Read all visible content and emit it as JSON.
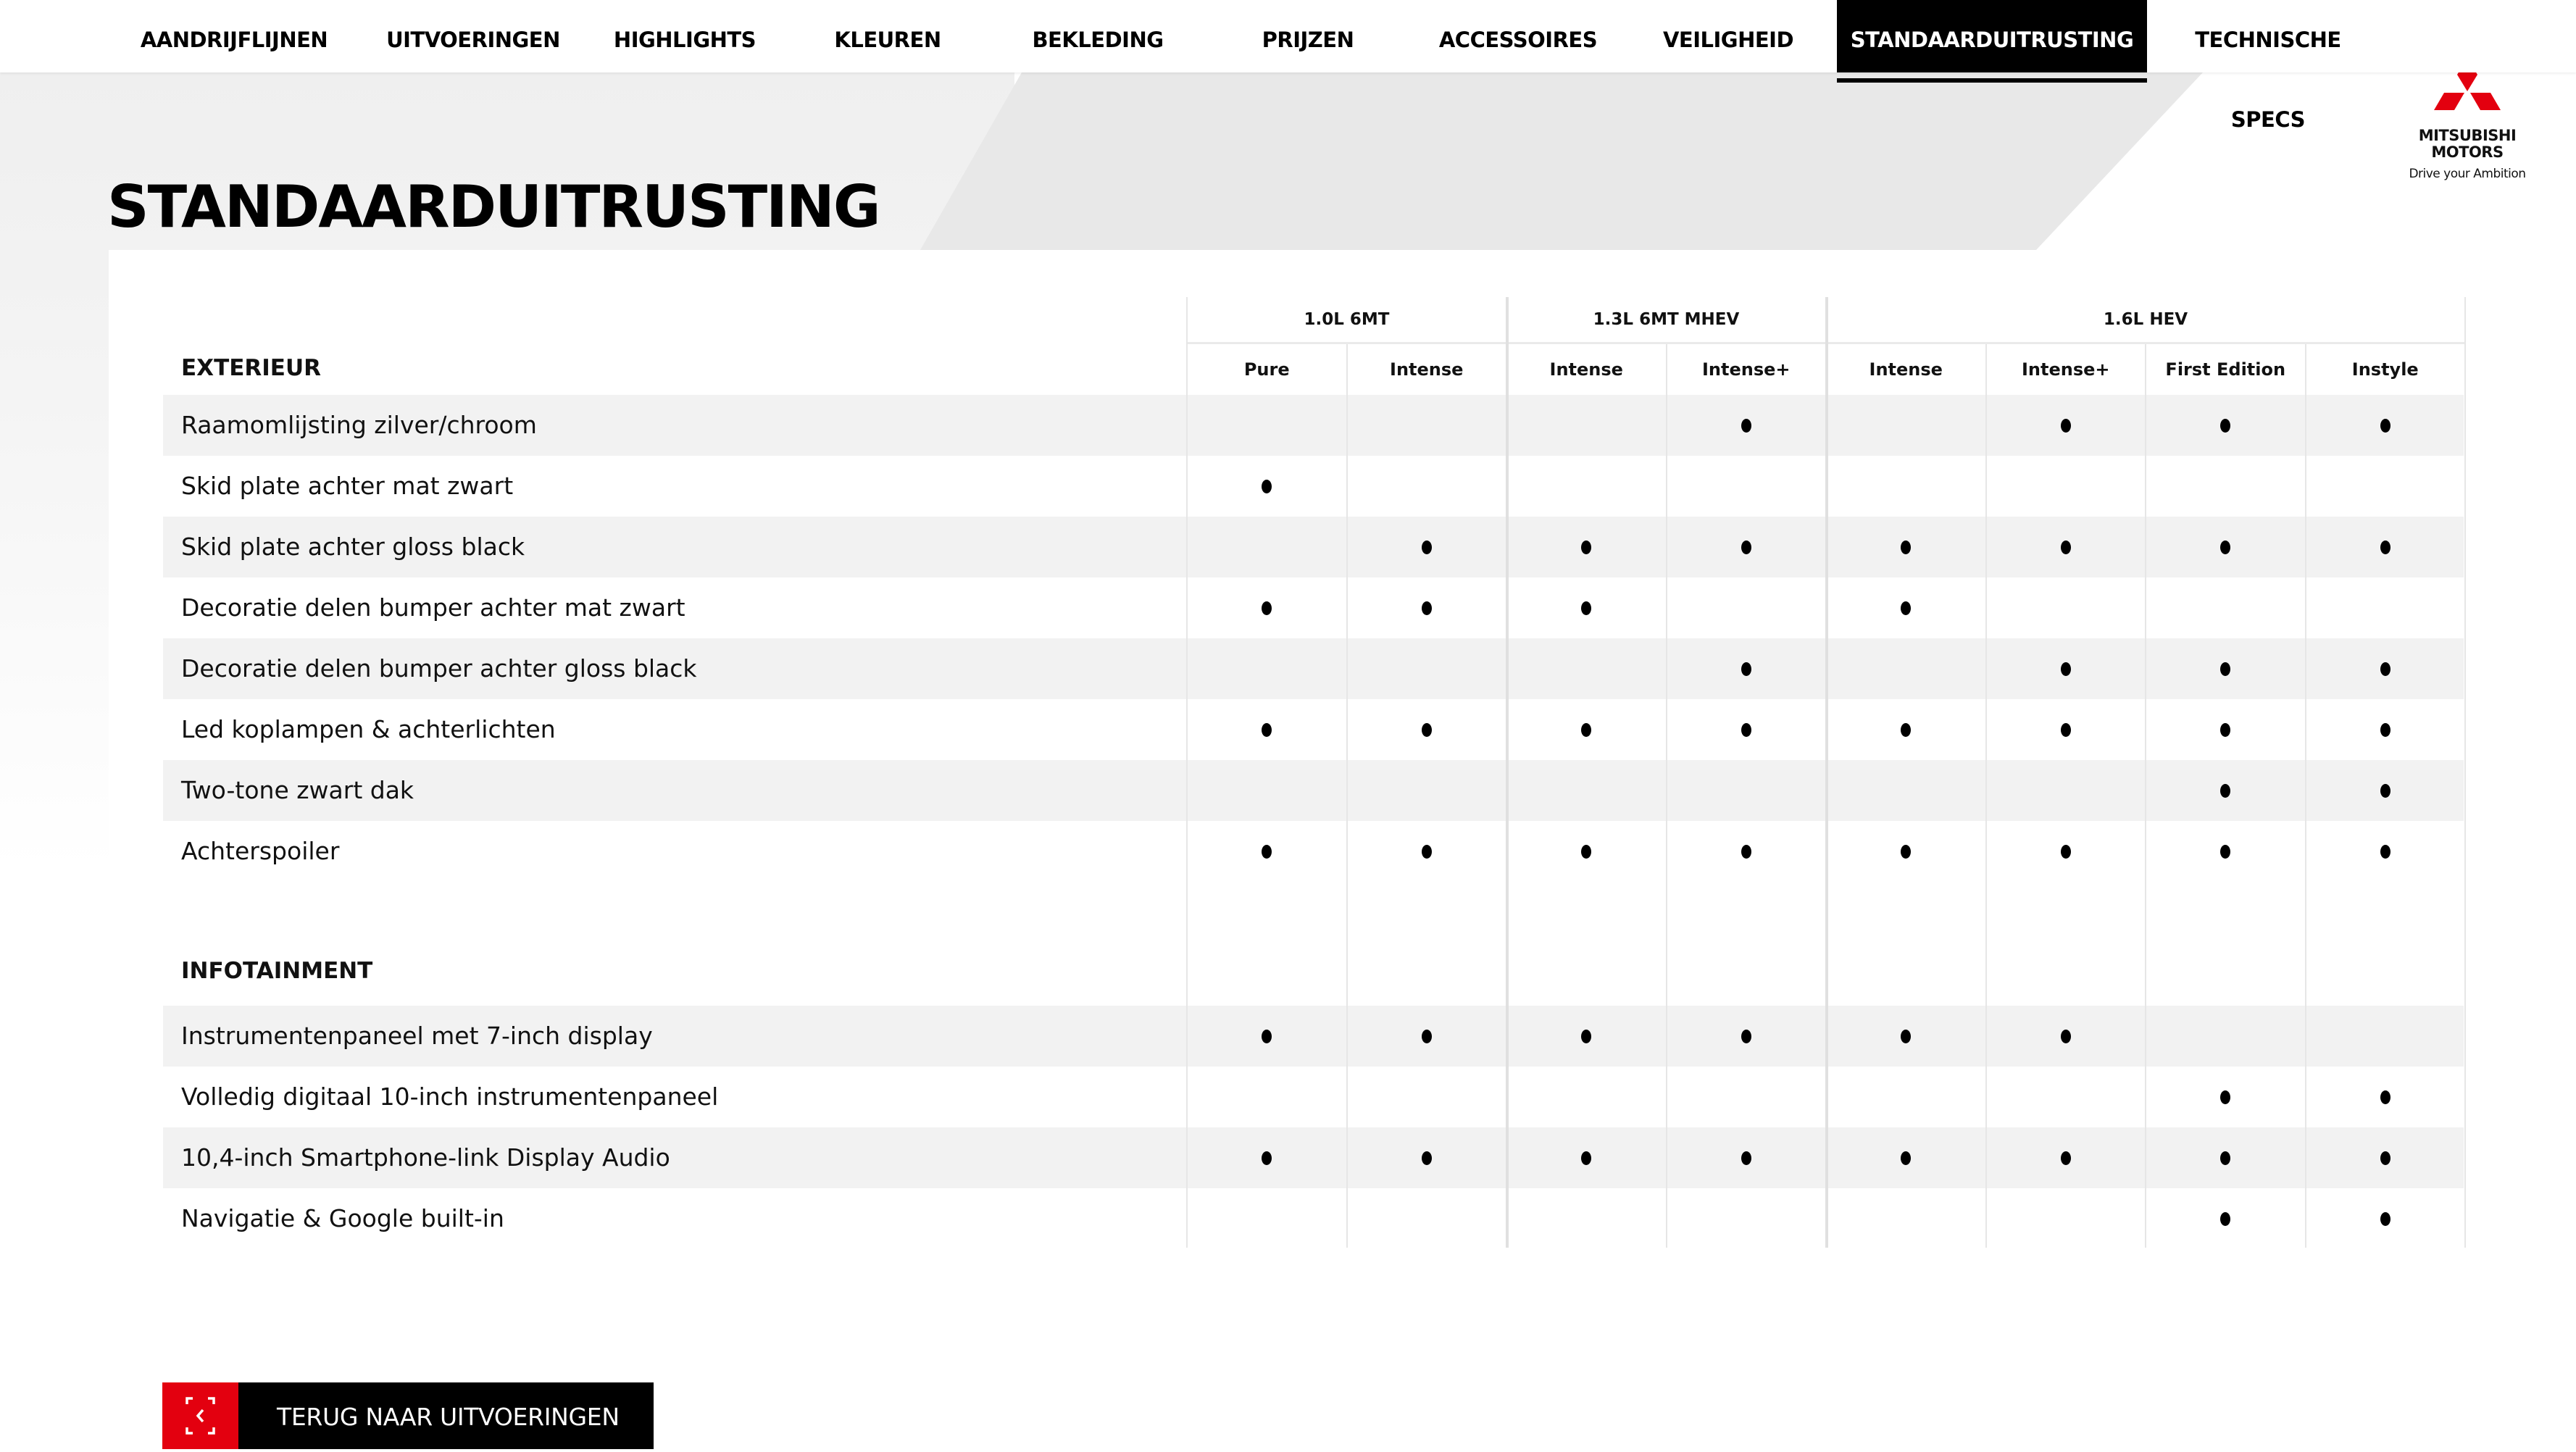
{
  "nav": {
    "items": [
      {
        "label": "AANDRIJFLIJNEN",
        "active": false
      },
      {
        "label": "UITVOERINGEN",
        "active": false
      },
      {
        "label": "HIGHLIGHTS",
        "active": false
      },
      {
        "label": "KLEUREN",
        "active": false
      },
      {
        "label": "BEKLEDING",
        "active": false
      },
      {
        "label": "PRIJZEN",
        "active": false
      },
      {
        "label": "ACCESSOIRES",
        "active": false
      },
      {
        "label": "VEILIGHEID",
        "active": false
      },
      {
        "label": "STANDAARDUITRUSTING",
        "active": true
      },
      {
        "label": "TECHNISCHE SPECS",
        "active": false
      }
    ]
  },
  "page": {
    "title": "STANDAARDUITRUSTING"
  },
  "brand": {
    "name_line1": "MITSUBISHI",
    "name_line2": "MOTORS",
    "tagline": "Drive your Ambition",
    "accent_color": "#e3000f"
  },
  "table": {
    "groups": [
      {
        "label": "1.0L 6MT",
        "span": 2
      },
      {
        "label": "1.3L 6MT MHEV",
        "span": 2
      },
      {
        "label": "1.6L HEV",
        "span": 4
      }
    ],
    "columns": [
      "Pure",
      "Intense",
      "Intense",
      "Intense+",
      "Intense",
      "Intense+",
      "First Edition",
      "Instyle"
    ],
    "sections": [
      {
        "title": "EXTERIEUR",
        "rows": [
          {
            "label": "Raamomlijsting zilver/chroom",
            "values": [
              0,
              0,
              0,
              1,
              0,
              1,
              1,
              1
            ]
          },
          {
            "label": "Skid plate achter mat zwart",
            "values": [
              1,
              0,
              0,
              0,
              0,
              0,
              0,
              0
            ]
          },
          {
            "label": "Skid plate achter gloss black",
            "values": [
              0,
              1,
              1,
              1,
              1,
              1,
              1,
              1
            ]
          },
          {
            "label": "Decoratie delen bumper achter mat zwart",
            "values": [
              1,
              1,
              1,
              0,
              1,
              0,
              0,
              0
            ]
          },
          {
            "label": "Decoratie delen bumper achter gloss black",
            "values": [
              0,
              0,
              0,
              1,
              0,
              1,
              1,
              1
            ]
          },
          {
            "label": "Led koplampen & achterlichten",
            "values": [
              1,
              1,
              1,
              1,
              1,
              1,
              1,
              1
            ]
          },
          {
            "label": "Two-tone zwart dak",
            "values": [
              0,
              0,
              0,
              0,
              0,
              0,
              1,
              1
            ]
          },
          {
            "label": "Achterspoiler",
            "values": [
              1,
              1,
              1,
              1,
              1,
              1,
              1,
              1
            ]
          }
        ]
      },
      {
        "title": "INFOTAINMENT",
        "rows": [
          {
            "label": "Instrumentenpaneel met 7-inch display",
            "values": [
              1,
              1,
              1,
              1,
              1,
              1,
              0,
              0
            ]
          },
          {
            "label": "Volledig digitaal 10-inch instrumentenpaneel",
            "values": [
              0,
              0,
              0,
              0,
              0,
              0,
              1,
              1
            ]
          },
          {
            "label": "10,4-inch Smartphone-link Display Audio",
            "values": [
              1,
              1,
              1,
              1,
              1,
              1,
              1,
              1
            ]
          },
          {
            "label": "Navigatie & Google built-in",
            "values": [
              0,
              0,
              0,
              0,
              0,
              0,
              1,
              1
            ]
          }
        ]
      }
    ]
  },
  "back_button": {
    "label": "TERUG NAAR UITVOERINGEN",
    "icon": "back-chevron-frame-icon"
  }
}
